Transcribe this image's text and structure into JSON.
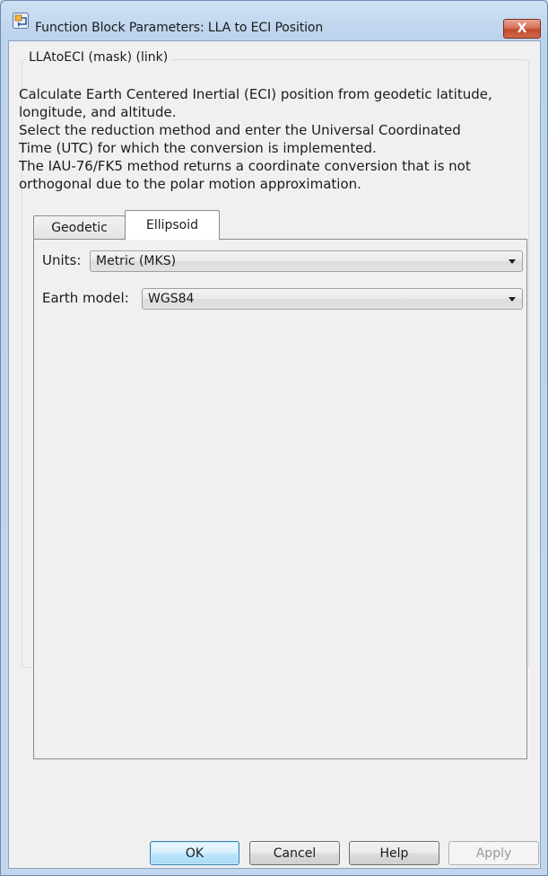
{
  "window": {
    "title": "Function Block Parameters: LLA to ECI Position",
    "close_label": "X"
  },
  "mask": {
    "legend": "LLAtoECI (mask) (link)",
    "description_lines": [
      "Calculate Earth Centered Inertial (ECI) position from geodetic latitude,",
      "longitude, and altitude.",
      "Select the reduction method and enter the Universal Coordinated",
      "Time (UTC) for which the conversion is implemented.",
      "The IAU-76/FK5 method returns a coordinate conversion that is not",
      "orthogonal due to the polar motion approximation."
    ]
  },
  "tabs": [
    {
      "label": "Geodetic",
      "active": false
    },
    {
      "label": "Ellipsoid",
      "active": true
    }
  ],
  "fields": {
    "units": {
      "label": "Units:",
      "value": "Metric (MKS)"
    },
    "earth_model": {
      "label": "Earth model:",
      "value": "WGS84"
    }
  },
  "buttons": {
    "ok": "OK",
    "cancel": "Cancel",
    "help": "Help",
    "apply": "Apply"
  },
  "colors": {
    "title_bar": "#bcd3ec",
    "close_button": "#c24a2f",
    "dialog_background": "#f0f0f0"
  },
  "icons": {
    "title": "simulink-block-icon",
    "close": "close-icon",
    "dropdown": "chevron-down-icon"
  }
}
